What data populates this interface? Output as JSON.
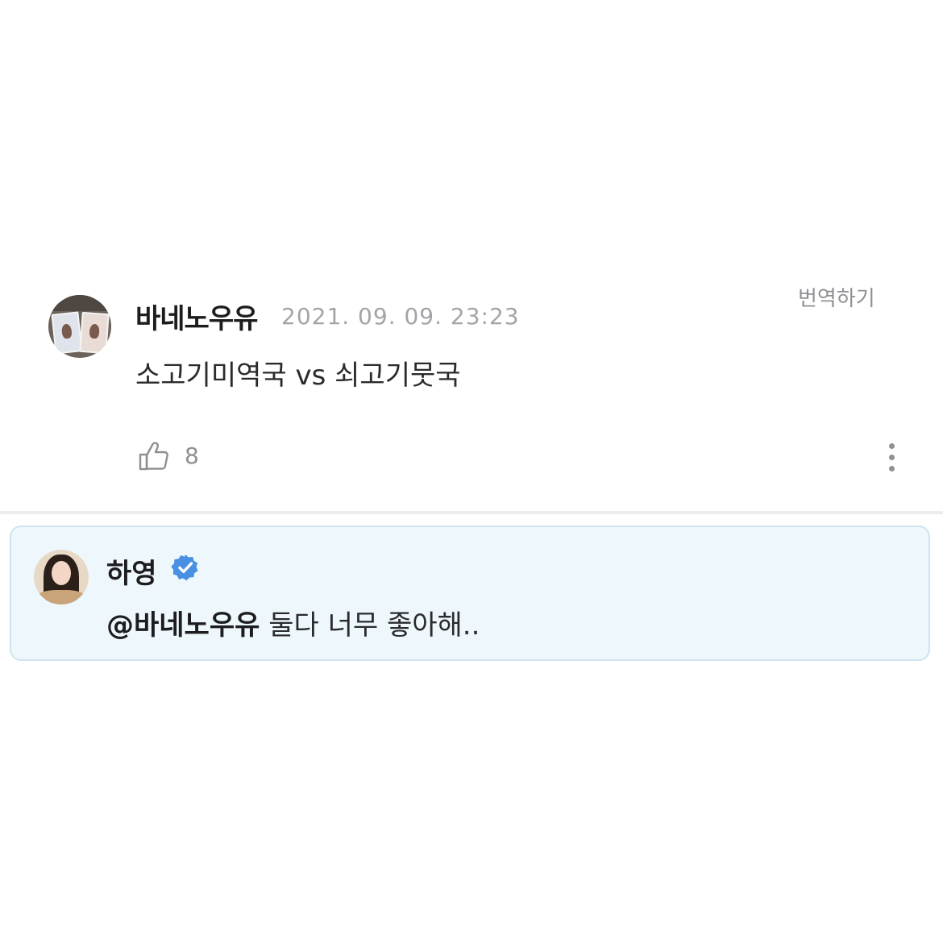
{
  "comment": {
    "author": "바네노우유",
    "timestamp": "2021. 09. 09. 23:23",
    "translate_label": "번역하기",
    "text": "소고기미역국 vs 쇠고기뭇국",
    "like_count": "8",
    "like_icon": "thumbs-up-icon",
    "more_icon": "more-vertical-icon"
  },
  "reply": {
    "author": "하영",
    "verified_icon": "verified-badge-icon",
    "mention": "@바네노우유",
    "text": " 둘다 너무 좋아해..",
    "background_color": "#eef7fc",
    "border_color": "#cfe3f0"
  },
  "colors": {
    "verified_blue": "#4a90e2",
    "secondary_text": "#8f8f94"
  }
}
